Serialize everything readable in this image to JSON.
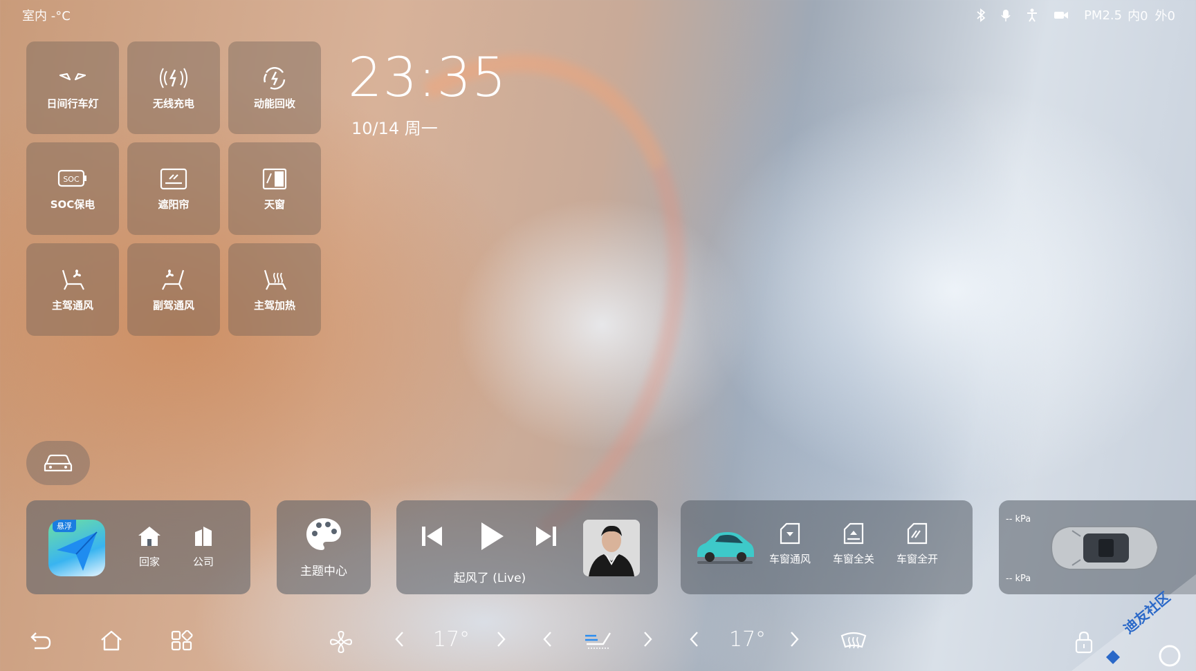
{
  "status_bar": {
    "indoor_temp": "室内 -°C",
    "pm_label": "PM2.5",
    "pm_inside": "内0",
    "pm_outside": "外0"
  },
  "quick_controls": [
    {
      "label": "日间行车灯",
      "icon": "daytime-running-light-icon"
    },
    {
      "label": "无线充电",
      "icon": "wireless-charging-icon"
    },
    {
      "label": "动能回收",
      "icon": "energy-recovery-icon"
    },
    {
      "label": "SOC保电",
      "icon": "soc-battery-icon"
    },
    {
      "label": "遮阳帘",
      "icon": "sunshade-icon"
    },
    {
      "label": "天窗",
      "icon": "sunroof-icon"
    },
    {
      "label": "主驾通风",
      "icon": "driver-seat-ventilation-icon"
    },
    {
      "label": "副驾通风",
      "icon": "passenger-seat-ventilation-icon"
    },
    {
      "label": "主驾加热",
      "icon": "driver-seat-heating-icon"
    }
  ],
  "clock": {
    "time": "23:35",
    "date": "10/14 周一"
  },
  "navigation": {
    "badge": "悬浮",
    "home_label": "回家",
    "work_label": "公司"
  },
  "theme": {
    "label": "主题中心"
  },
  "music": {
    "song_title": "起风了 (Live)"
  },
  "windows": {
    "vent_label": "车窗通风",
    "close_label": "车窗全关",
    "open_label": "车窗全开"
  },
  "tires": {
    "unit_front": "-- kPa",
    "unit_rear": "-- kPa"
  },
  "climate": {
    "left_temp": "17°",
    "right_temp": "17°"
  },
  "watermark": {
    "text": "迪友社区"
  },
  "colors": {
    "car_teal": "#3ec9c9",
    "card_bg": "#55606a"
  }
}
